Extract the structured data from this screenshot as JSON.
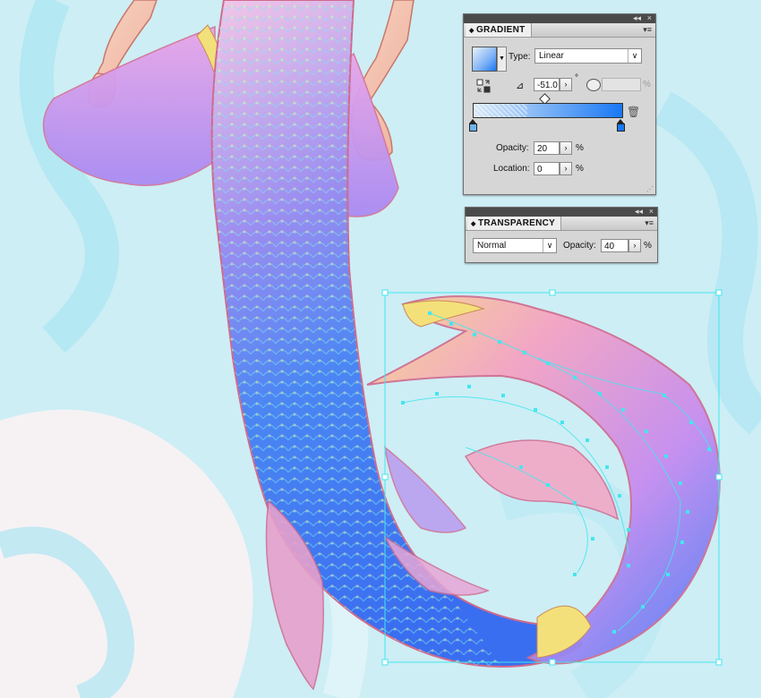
{
  "gradient_panel": {
    "title": "GRADIENT",
    "type_label": "Type:",
    "type_value": "Linear",
    "angle_value": "-51.0",
    "degree_symbol": "°",
    "aspect_unit": "%",
    "opacity_label": "Opacity:",
    "opacity_value": "20",
    "opacity_unit": "%",
    "location_label": "Location:",
    "location_value": "0",
    "location_unit": "%",
    "gradient_start_color": "#d6e8f7",
    "gradient_end_color": "#1a78f5"
  },
  "transparency_panel": {
    "title": "TRANSPARENCY",
    "blend_mode": "Normal",
    "opacity_label": "Opacity:",
    "opacity_value": "40",
    "opacity_unit": "%"
  },
  "panel_controls": {
    "collapse": "◂◂",
    "close": "×",
    "menu": "▾≡"
  },
  "artwork": {
    "background_color": "#cdeef5",
    "selection_color": "#44e6ef",
    "tail_colors": [
      "#f6a2c8",
      "#b57cf0",
      "#3f7cf2",
      "#2f9af2"
    ]
  }
}
